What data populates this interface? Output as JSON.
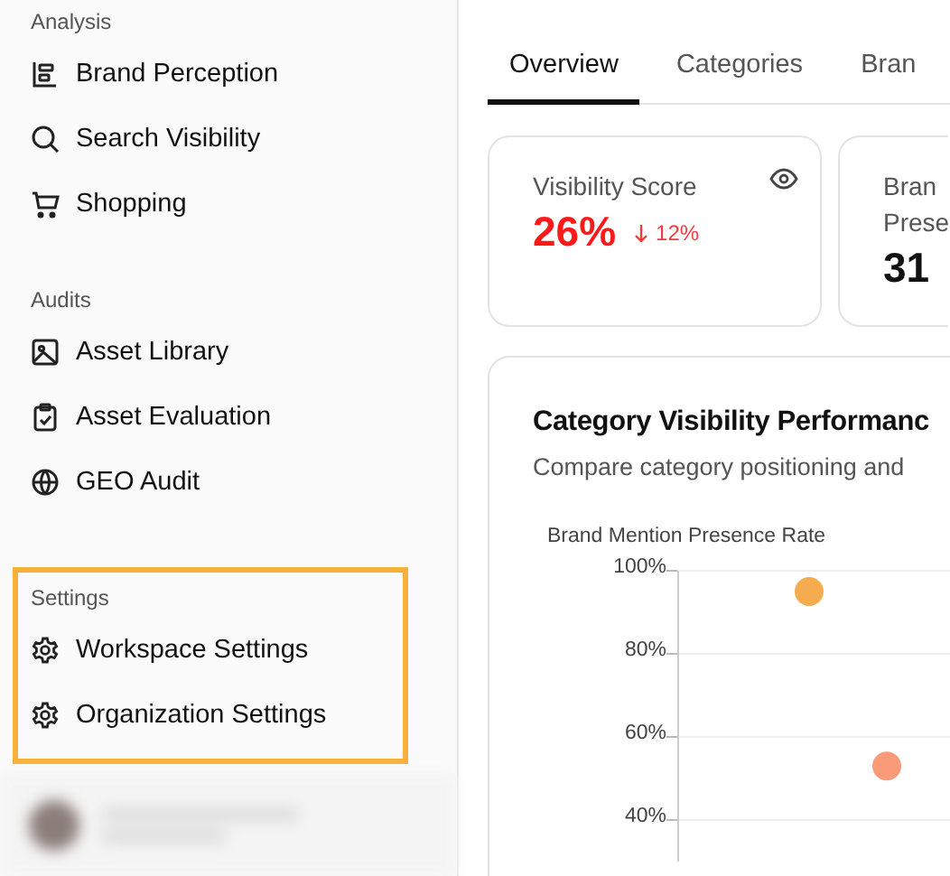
{
  "sidebar": {
    "sections": [
      {
        "title": "Analysis",
        "highlighted": false,
        "items": [
          {
            "label": "Brand Perception"
          },
          {
            "label": "Search Visibility"
          },
          {
            "label": "Shopping"
          }
        ]
      },
      {
        "title": "Audits",
        "highlighted": false,
        "items": [
          {
            "label": "Asset Library"
          },
          {
            "label": "Asset Evaluation"
          },
          {
            "label": "GEO Audit"
          }
        ]
      },
      {
        "title": "Settings",
        "highlighted": true,
        "items": [
          {
            "label": "Workspace Settings"
          },
          {
            "label": "Organization Settings"
          }
        ]
      }
    ]
  },
  "tabs": [
    {
      "label": "Overview",
      "selected": true
    },
    {
      "label": "Categories",
      "selected": false
    },
    {
      "label": "Bran",
      "selected": false
    }
  ],
  "metric_cards": [
    {
      "title": "Visibility Score",
      "value": "26%",
      "change": "12%",
      "declining": true,
      "visibility_toggle": true
    },
    {
      "title_lines": [
        "Bran",
        "Prese"
      ],
      "value": "31"
    }
  ],
  "chart_card": {
    "title": "Category Visibility Performanc",
    "subtitle": "Compare category positioning and",
    "chart_data": {
      "type": "scatter",
      "ylabel": "Brand Mention Presence Rate",
      "ylim": [
        30,
        100
      ],
      "grid": true,
      "yticks": [
        {
          "value": 100,
          "label": "100%"
        },
        {
          "value": 80,
          "label": "80%"
        },
        {
          "value": 60,
          "label": "60%"
        },
        {
          "value": 40,
          "label": "40%"
        }
      ],
      "series": [
        {
          "color": "#f5ac4e",
          "values": [
            95
          ]
        },
        {
          "color": "#f99a78",
          "values": [
            53
          ]
        }
      ]
    }
  }
}
